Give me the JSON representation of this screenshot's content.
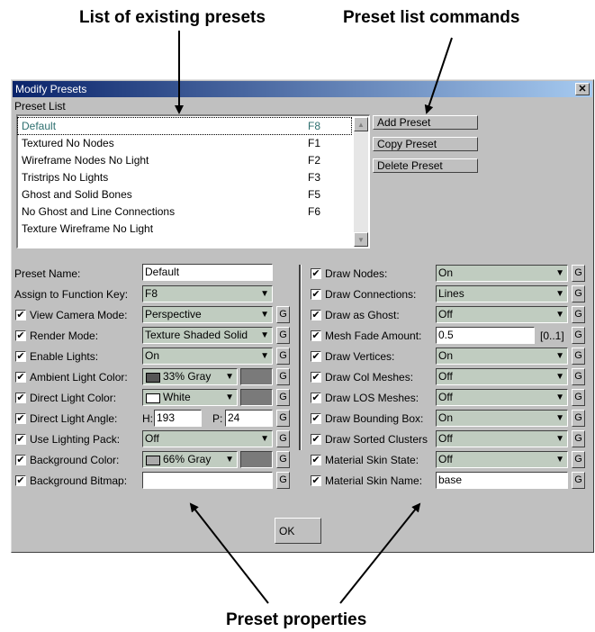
{
  "callouts": {
    "list_presets": "List of existing presets",
    "list_commands": "Preset list commands",
    "properties": "Preset properties"
  },
  "window": {
    "title": "Modify Presets",
    "close": "✕",
    "preset_list_label": "Preset List"
  },
  "presets": [
    {
      "name": "Default",
      "key": "F8",
      "selected": true
    },
    {
      "name": "Textured No Nodes",
      "key": "F1"
    },
    {
      "name": "Wireframe Nodes No Light",
      "key": "F2"
    },
    {
      "name": "Tristrips No Lights",
      "key": "F3"
    },
    {
      "name": "Ghost and Solid Bones",
      "key": "F5"
    },
    {
      "name": "No Ghost and Line Connections",
      "key": "F6"
    },
    {
      "name": "Texture Wireframe No Light",
      "key": ""
    }
  ],
  "scroll": {
    "up": "▲",
    "down": "▼"
  },
  "commands": {
    "add": "Add Preset",
    "copy": "Copy Preset",
    "delete": "Delete Preset"
  },
  "left": {
    "preset_name_label": "Preset Name:",
    "preset_name_value": "Default",
    "function_key_label": "Assign to Function Key:",
    "function_key_value": "F8",
    "view_camera_label": "View Camera Mode:",
    "view_camera_value": "Perspective",
    "render_mode_label": "Render Mode:",
    "render_mode_value": "Texture Shaded Solid",
    "enable_lights_label": "Enable Lights:",
    "enable_lights_value": "On",
    "ambient_label": "Ambient Light Color:",
    "ambient_value": "33% Gray",
    "direct_color_label": "Direct Light Color:",
    "direct_color_value": "White",
    "direct_angle_label": "Direct Light Angle:",
    "h_label": "H:",
    "h_value": "193",
    "p_label": "P:",
    "p_value": "24",
    "lighting_pack_label": "Use Lighting Pack:",
    "lighting_pack_value": "Off",
    "bg_color_label": "Background Color:",
    "bg_color_value": "66% Gray",
    "bg_bitmap_label": "Background Bitmap:",
    "bg_bitmap_value": ""
  },
  "right": {
    "draw_nodes_label": "Draw Nodes:",
    "draw_nodes_value": "On",
    "draw_conn_label": "Draw Connections:",
    "draw_conn_value": "Lines",
    "ghost_label": "Draw as Ghost:",
    "ghost_value": "Off",
    "mesh_fade_label": "Mesh Fade Amount:",
    "mesh_fade_value": "0.5",
    "mesh_fade_range": "[0..1]",
    "vertices_label": "Draw Vertices:",
    "vertices_value": "On",
    "col_label": "Draw Col Meshes:",
    "col_value": "Off",
    "los_label": "Draw LOS Meshes:",
    "los_value": "Off",
    "bbox_label": "Draw Bounding Box:",
    "bbox_value": "On",
    "clusters_label": "Draw Sorted Clusters",
    "clusters_value": "Off",
    "skin_state_label": "Material Skin State:",
    "skin_state_value": "Off",
    "skin_name_label": "Material Skin Name:",
    "skin_name_value": "base"
  },
  "glyphs": {
    "check": "✔",
    "dropdown": "▼",
    "g": "G"
  },
  "colors": {
    "titlebar_start": "#0a246a",
    "titlebar_end": "#a6caf0",
    "dropdown_bg": "#c0ccc0",
    "dialog_bg": "#c0c0c0"
  },
  "swatches": {
    "ambient": "#555555",
    "direct": "#ffffff",
    "background": "#aaaaaa"
  },
  "ok": "OK"
}
